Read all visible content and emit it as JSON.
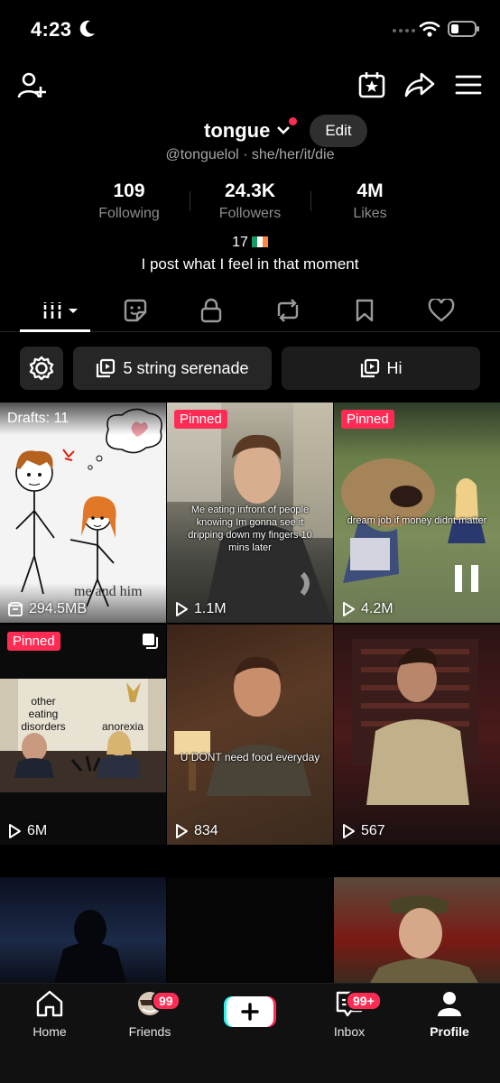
{
  "status_bar": {
    "time": "4:23"
  },
  "profile": {
    "username": "tongue",
    "edit_label": "Edit",
    "handle_line": "@tonguelol · she/her/it/die",
    "stats": [
      {
        "value": "109",
        "label": "Following"
      },
      {
        "value": "24.3K",
        "label": "Followers"
      },
      {
        "value": "4M",
        "label": "Likes"
      }
    ],
    "age": "17",
    "bio": "I post what I feel in that moment"
  },
  "playlists": [
    {
      "label": "5 string serenade"
    },
    {
      "label": "Hi"
    }
  ],
  "grid": {
    "items": [
      {
        "overlay": "Drafts: 11",
        "stat": "294.5MB",
        "caption": "me and him"
      },
      {
        "pinned": "Pinned",
        "stat": "1.1M",
        "caption": "Me eating infront of people knowing Im gonna see it dripping down my fingers 10 mins later"
      },
      {
        "pinned": "Pinned",
        "stat": "4.2M",
        "caption": "dream job if money didnt matter"
      },
      {
        "pinned": "Pinned",
        "stat": "6M",
        "caption_left": "other eating disorders",
        "caption_right": "anorexia"
      },
      {
        "stat": "834",
        "caption": "U DONT need food everyday"
      },
      {
        "stat": "567"
      },
      {},
      {},
      {}
    ]
  },
  "nav": {
    "home": "Home",
    "friends": "Friends",
    "friends_badge": "99",
    "inbox": "Inbox",
    "inbox_badge": "99+",
    "profile": "Profile"
  },
  "colors": {
    "accent": "#fe2c55",
    "background": "#000000",
    "pill": "#262626"
  }
}
